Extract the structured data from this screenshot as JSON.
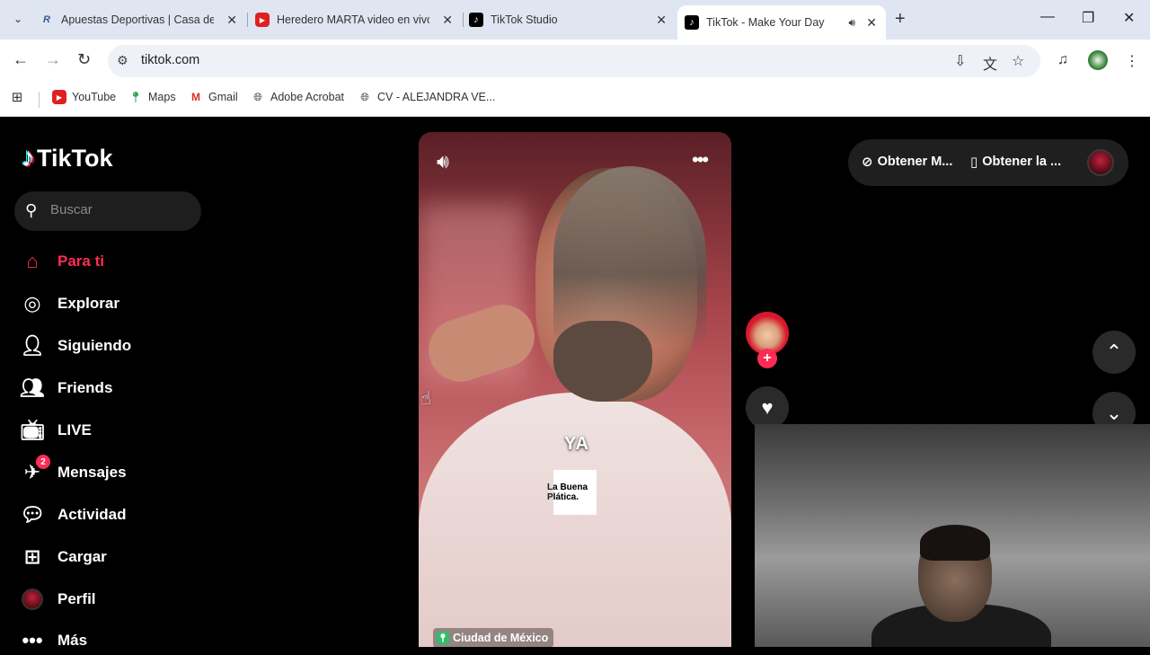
{
  "browser": {
    "tabs": [
      {
        "title": "Apuestas Deportivas | Casa de A",
        "icon": "betting-site-icon",
        "active": false
      },
      {
        "title": "Heredero MARTA video en vivo",
        "icon": "youtube-icon",
        "active": false
      },
      {
        "title": "TikTok Studio",
        "icon": "tiktok-icon",
        "active": false
      },
      {
        "title": "TikTok - Make Your Day",
        "icon": "tiktok-icon",
        "active": true
      }
    ],
    "address": "tiktok.com",
    "bookmarks": [
      {
        "label": "YouTube",
        "icon": "youtube-icon"
      },
      {
        "label": "Maps",
        "icon": "maps-icon"
      },
      {
        "label": "Gmail",
        "icon": "gmail-icon"
      },
      {
        "label": "Adobe Acrobat",
        "icon": "globe-icon"
      },
      {
        "label": "CV - ALEJANDRA VE...",
        "icon": "globe-icon"
      }
    ]
  },
  "tiktok": {
    "logo": "TikTok",
    "search_placeholder": "Buscar",
    "nav": [
      {
        "label": "Para ti",
        "icon": "home-icon",
        "active": true
      },
      {
        "label": "Explorar",
        "icon": "compass-icon"
      },
      {
        "label": "Siguiendo",
        "icon": "following-icon"
      },
      {
        "label": "Friends",
        "icon": "friends-icon"
      },
      {
        "label": "LIVE",
        "icon": "live-icon"
      },
      {
        "label": "Mensajes",
        "icon": "messages-icon",
        "badge": "2"
      },
      {
        "label": "Actividad",
        "icon": "activity-icon"
      },
      {
        "label": "Cargar",
        "icon": "upload-icon"
      },
      {
        "label": "Perfil",
        "icon": "profile-avatar-icon"
      },
      {
        "label": "Más",
        "icon": "more-icon"
      }
    ],
    "video": {
      "caption_word": "YA",
      "brand": "La Buena Plática.",
      "location": "Ciudad de México"
    },
    "top_links": [
      {
        "label": "Obtener M...",
        "icon": "coin-icon"
      },
      {
        "label": "Obtener la ...",
        "icon": "phone-icon"
      }
    ],
    "colors": {
      "accent": "#fe2c55",
      "background": "#000000"
    }
  }
}
